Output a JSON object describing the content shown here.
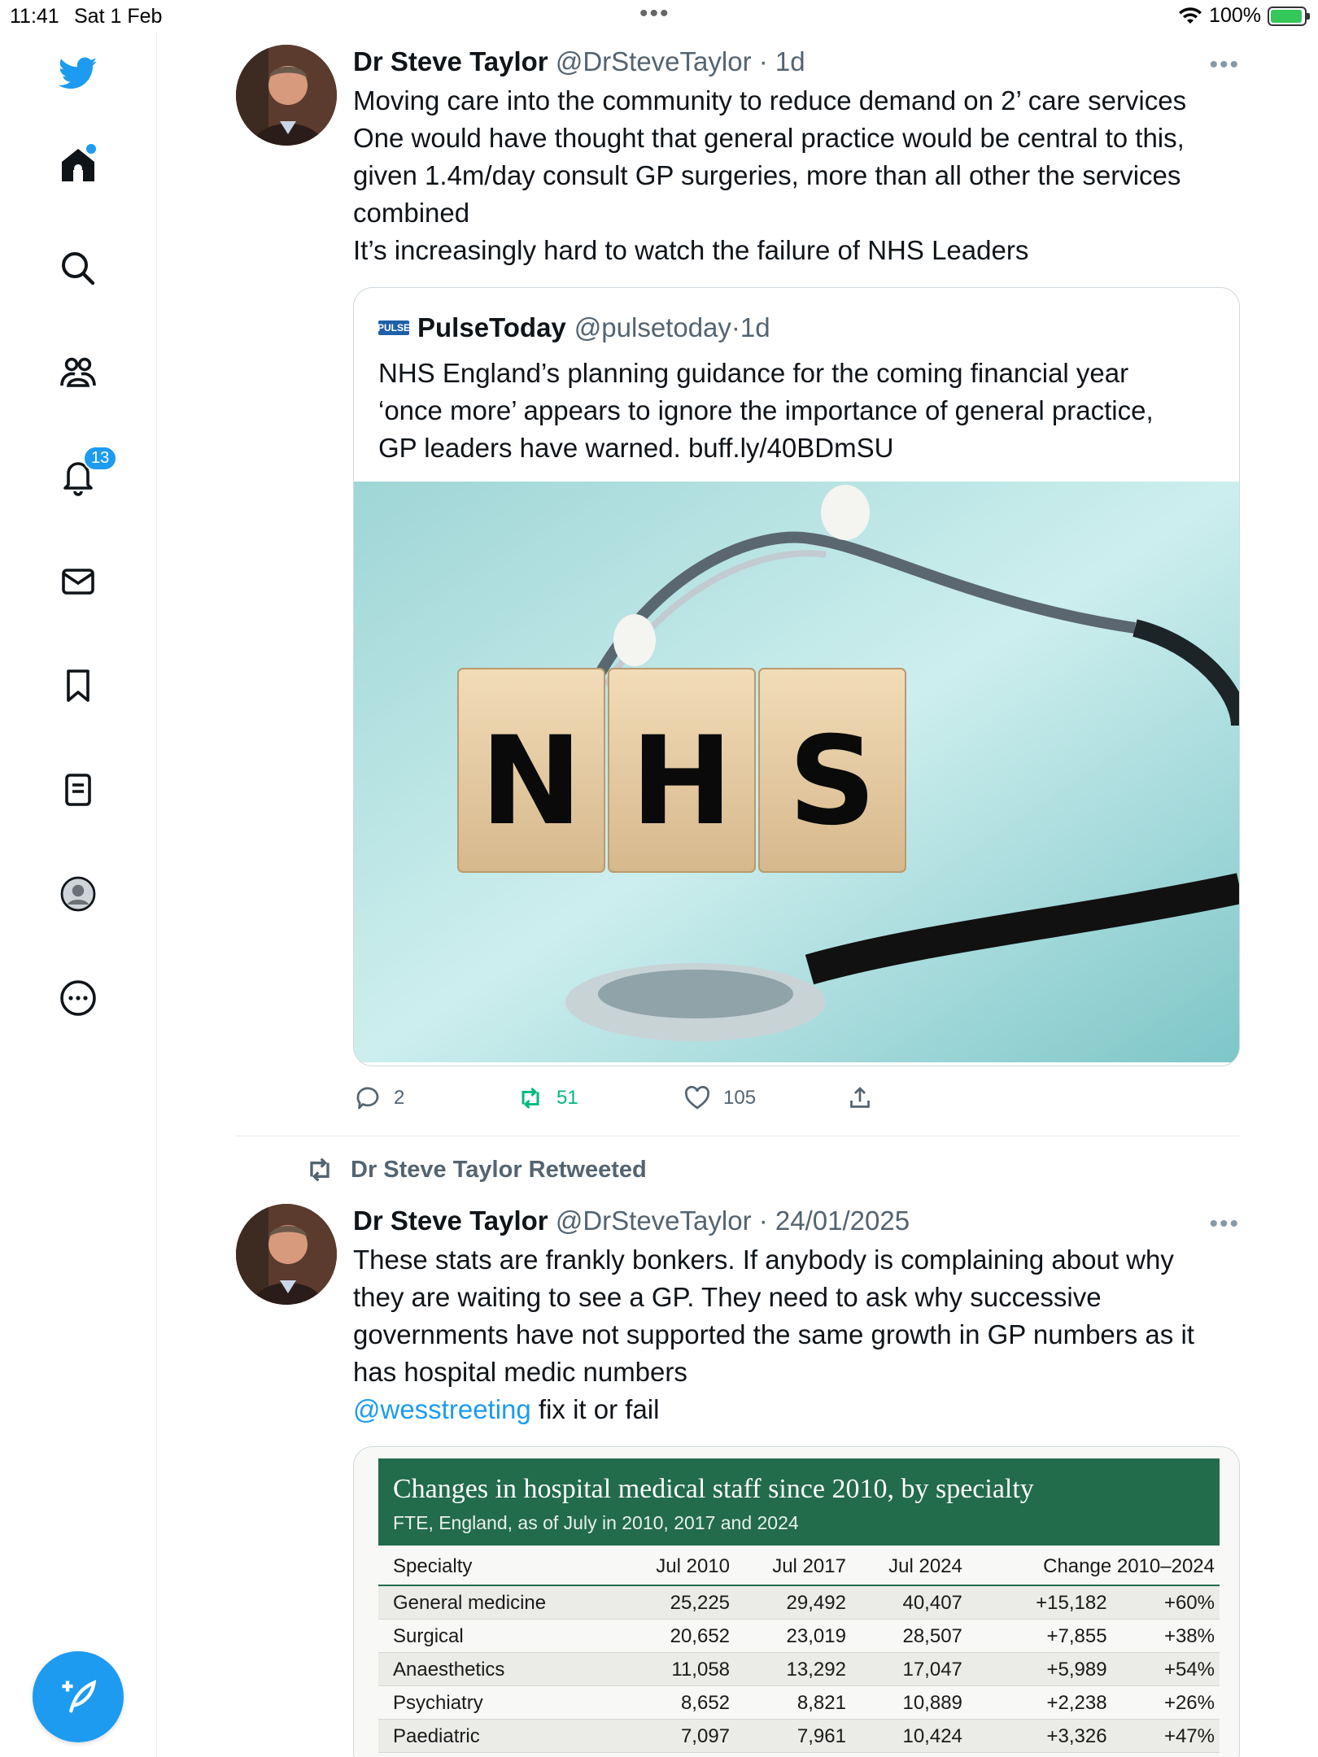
{
  "status_bar": {
    "time": "11:41",
    "date": "Sat 1 Feb",
    "battery": "100%"
  },
  "sidebar": {
    "notifications_badge": "13"
  },
  "tweet1": {
    "name": "Dr Steve Taylor",
    "handle": "@DrSteveTaylor",
    "time": "1d",
    "text_lines": [
      "Moving care into the community to reduce demand on 2’ care services",
      "One would have thought that general practice would be central to this,",
      "given 1.4m/day consult GP surgeries, more than all other the services",
      "combined",
      "It’s increasingly hard to watch the failure of NHS Leaders"
    ],
    "quote": {
      "logo": "PULSE",
      "name": "PulseToday",
      "handle": "@pulsetoday",
      "time": "1d",
      "text_lines": [
        "NHS England’s planning guidance for the coming financial year",
        "‘once more’ appears to ignore the importance of general practice,",
        "GP leaders have warned. buff.ly/40BDmSU"
      ],
      "image_letters": [
        "N",
        "H",
        "S"
      ]
    },
    "replies": "2",
    "retweets": "51",
    "likes": "105"
  },
  "retweet_banner": "Dr Steve Taylor Retweeted",
  "tweet2": {
    "name": "Dr Steve Taylor",
    "handle": "@DrSteveTaylor",
    "time": "24/01/2025",
    "text_lines": [
      "These stats are frankly bonkers. If anybody is complaining about why",
      "they are waiting to see a GP. They need to ask why successive",
      "governments have not supported the same growth in GP numbers as it",
      "has hospital medic numbers"
    ],
    "mention": "@wesstreeting",
    "mention_suffix": " fix it or fail",
    "table": {
      "title": "Changes in hospital medical staff since 2010, by specialty",
      "subtitle": "FTE, England, as of July in 2010, 2017 and 2024",
      "columns": [
        "Specialty",
        "Jul 2010",
        "Jul 2017",
        "Jul 2024",
        "Change 2010–2024",
        ""
      ],
      "rows": [
        [
          "General medicine",
          "25,225",
          "29,492",
          "40,407",
          "+15,182",
          "+60%"
        ],
        [
          "Surgical",
          "20,652",
          "23,019",
          "28,507",
          "+7,855",
          "+38%"
        ],
        [
          "Anaesthetics",
          "11,058",
          "13,292",
          "17,047",
          "+5,989",
          "+54%"
        ],
        [
          "Psychiatry",
          "8,652",
          "8,821",
          "10,889",
          "+2,238",
          "+26%"
        ],
        [
          "Paediatric",
          "7,097",
          "7,961",
          "10,424",
          "+3,326",
          "+47%"
        ]
      ]
    }
  }
}
